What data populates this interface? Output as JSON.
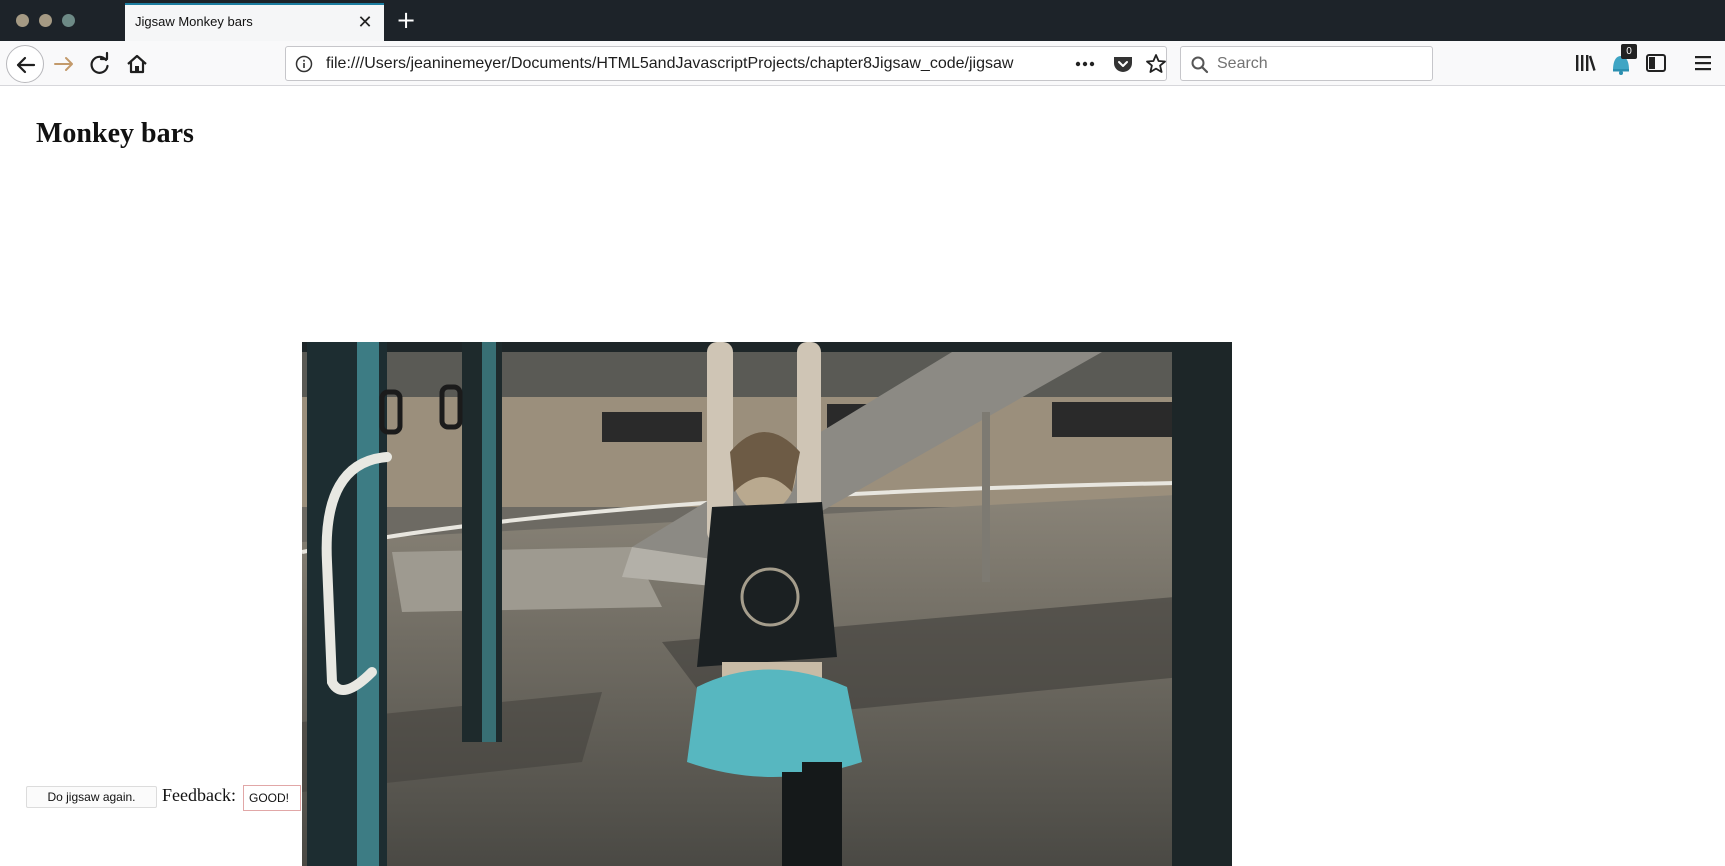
{
  "window": {
    "tab_title": "Jigsaw Monkey bars"
  },
  "navbar": {
    "url": "file:///Users/jeaninemeyer/Documents/HTML5andJavascriptProjects/chapter8Jigsaw_code/jigsaw",
    "search_placeholder": "Search",
    "library_badge": "0"
  },
  "page": {
    "heading": "Monkey bars",
    "photo_name": "monkey-bars-photo"
  },
  "controls": {
    "again_label": "Do jigsaw again.",
    "feedback_label": "Feedback:",
    "feedback_value": "GOOD!"
  },
  "colors": {
    "accent": "#1c7da0",
    "teal": "#57b7c0",
    "titlebar": "#1d2329"
  },
  "icons": [
    "back-icon",
    "forward-icon",
    "reload-icon",
    "home-icon",
    "info-icon",
    "more-icon",
    "pocket-icon",
    "star-icon",
    "search-icon",
    "library-icon",
    "sync-icon",
    "sidebar-icon",
    "menu-icon"
  ]
}
